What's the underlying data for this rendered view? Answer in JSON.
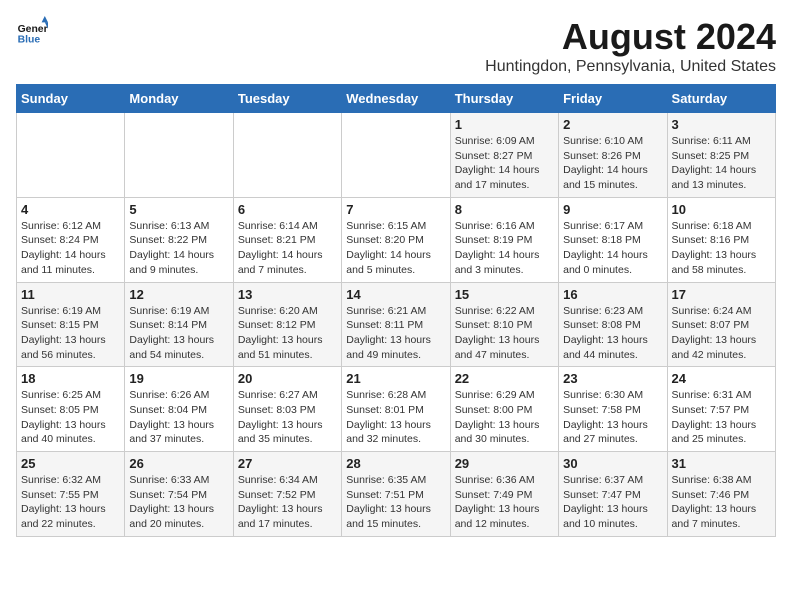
{
  "header": {
    "logo_line1": "General",
    "logo_line2": "Blue",
    "title": "August 2024",
    "subtitle": "Huntingdon, Pennsylvania, United States"
  },
  "weekdays": [
    "Sunday",
    "Monday",
    "Tuesday",
    "Wednesday",
    "Thursday",
    "Friday",
    "Saturday"
  ],
  "weeks": [
    [
      {
        "day": "",
        "info": ""
      },
      {
        "day": "",
        "info": ""
      },
      {
        "day": "",
        "info": ""
      },
      {
        "day": "",
        "info": ""
      },
      {
        "day": "1",
        "info": "Sunrise: 6:09 AM\nSunset: 8:27 PM\nDaylight: 14 hours\nand 17 minutes."
      },
      {
        "day": "2",
        "info": "Sunrise: 6:10 AM\nSunset: 8:26 PM\nDaylight: 14 hours\nand 15 minutes."
      },
      {
        "day": "3",
        "info": "Sunrise: 6:11 AM\nSunset: 8:25 PM\nDaylight: 14 hours\nand 13 minutes."
      }
    ],
    [
      {
        "day": "4",
        "info": "Sunrise: 6:12 AM\nSunset: 8:24 PM\nDaylight: 14 hours\nand 11 minutes."
      },
      {
        "day": "5",
        "info": "Sunrise: 6:13 AM\nSunset: 8:22 PM\nDaylight: 14 hours\nand 9 minutes."
      },
      {
        "day": "6",
        "info": "Sunrise: 6:14 AM\nSunset: 8:21 PM\nDaylight: 14 hours\nand 7 minutes."
      },
      {
        "day": "7",
        "info": "Sunrise: 6:15 AM\nSunset: 8:20 PM\nDaylight: 14 hours\nand 5 minutes."
      },
      {
        "day": "8",
        "info": "Sunrise: 6:16 AM\nSunset: 8:19 PM\nDaylight: 14 hours\nand 3 minutes."
      },
      {
        "day": "9",
        "info": "Sunrise: 6:17 AM\nSunset: 8:18 PM\nDaylight: 14 hours\nand 0 minutes."
      },
      {
        "day": "10",
        "info": "Sunrise: 6:18 AM\nSunset: 8:16 PM\nDaylight: 13 hours\nand 58 minutes."
      }
    ],
    [
      {
        "day": "11",
        "info": "Sunrise: 6:19 AM\nSunset: 8:15 PM\nDaylight: 13 hours\nand 56 minutes."
      },
      {
        "day": "12",
        "info": "Sunrise: 6:19 AM\nSunset: 8:14 PM\nDaylight: 13 hours\nand 54 minutes."
      },
      {
        "day": "13",
        "info": "Sunrise: 6:20 AM\nSunset: 8:12 PM\nDaylight: 13 hours\nand 51 minutes."
      },
      {
        "day": "14",
        "info": "Sunrise: 6:21 AM\nSunset: 8:11 PM\nDaylight: 13 hours\nand 49 minutes."
      },
      {
        "day": "15",
        "info": "Sunrise: 6:22 AM\nSunset: 8:10 PM\nDaylight: 13 hours\nand 47 minutes."
      },
      {
        "day": "16",
        "info": "Sunrise: 6:23 AM\nSunset: 8:08 PM\nDaylight: 13 hours\nand 44 minutes."
      },
      {
        "day": "17",
        "info": "Sunrise: 6:24 AM\nSunset: 8:07 PM\nDaylight: 13 hours\nand 42 minutes."
      }
    ],
    [
      {
        "day": "18",
        "info": "Sunrise: 6:25 AM\nSunset: 8:05 PM\nDaylight: 13 hours\nand 40 minutes."
      },
      {
        "day": "19",
        "info": "Sunrise: 6:26 AM\nSunset: 8:04 PM\nDaylight: 13 hours\nand 37 minutes."
      },
      {
        "day": "20",
        "info": "Sunrise: 6:27 AM\nSunset: 8:03 PM\nDaylight: 13 hours\nand 35 minutes."
      },
      {
        "day": "21",
        "info": "Sunrise: 6:28 AM\nSunset: 8:01 PM\nDaylight: 13 hours\nand 32 minutes."
      },
      {
        "day": "22",
        "info": "Sunrise: 6:29 AM\nSunset: 8:00 PM\nDaylight: 13 hours\nand 30 minutes."
      },
      {
        "day": "23",
        "info": "Sunrise: 6:30 AM\nSunset: 7:58 PM\nDaylight: 13 hours\nand 27 minutes."
      },
      {
        "day": "24",
        "info": "Sunrise: 6:31 AM\nSunset: 7:57 PM\nDaylight: 13 hours\nand 25 minutes."
      }
    ],
    [
      {
        "day": "25",
        "info": "Sunrise: 6:32 AM\nSunset: 7:55 PM\nDaylight: 13 hours\nand 22 minutes."
      },
      {
        "day": "26",
        "info": "Sunrise: 6:33 AM\nSunset: 7:54 PM\nDaylight: 13 hours\nand 20 minutes."
      },
      {
        "day": "27",
        "info": "Sunrise: 6:34 AM\nSunset: 7:52 PM\nDaylight: 13 hours\nand 17 minutes."
      },
      {
        "day": "28",
        "info": "Sunrise: 6:35 AM\nSunset: 7:51 PM\nDaylight: 13 hours\nand 15 minutes."
      },
      {
        "day": "29",
        "info": "Sunrise: 6:36 AM\nSunset: 7:49 PM\nDaylight: 13 hours\nand 12 minutes."
      },
      {
        "day": "30",
        "info": "Sunrise: 6:37 AM\nSunset: 7:47 PM\nDaylight: 13 hours\nand 10 minutes."
      },
      {
        "day": "31",
        "info": "Sunrise: 6:38 AM\nSunset: 7:46 PM\nDaylight: 13 hours\nand 7 minutes."
      }
    ]
  ]
}
